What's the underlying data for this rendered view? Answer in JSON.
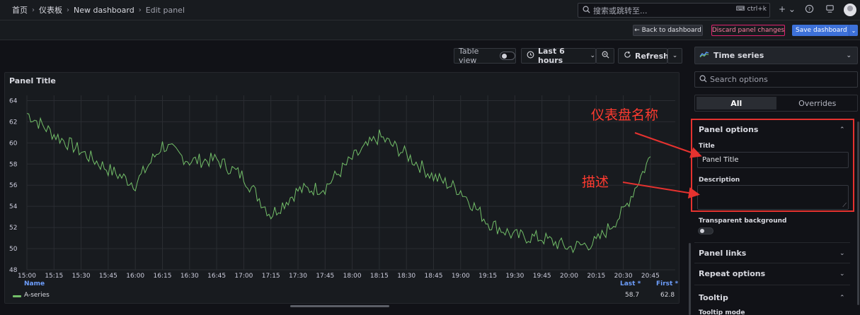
{
  "breadcrumbs": [
    "首页",
    "仪表板",
    "New dashboard",
    "Edit panel"
  ],
  "search": {
    "placeholder": "搜索或跳转至...",
    "shortcut": "ctrl+k"
  },
  "actions": {
    "back": "← Back to dashboard",
    "discard": "Discard panel changes",
    "save": "Save dashboard"
  },
  "toolbar": {
    "table_view": "Table view",
    "time_range": "Last 6 hours",
    "refresh": "Refresh"
  },
  "panel": {
    "title": "Panel Title"
  },
  "legend": {
    "name_header": "Name",
    "last_header": "Last *",
    "first_header": "First *",
    "series_name": "A-series",
    "last_value": "58.7",
    "first_value": "62.8"
  },
  "options": {
    "viz_type": "Time series",
    "search_placeholder": "Search options",
    "tab_all": "All",
    "tab_overrides": "Overrides",
    "panel_options": "Panel options",
    "title_label": "Title",
    "title_value": "Panel Title",
    "description_label": "Description",
    "description_value": "",
    "transparent_label": "Transparent background",
    "panel_links": "Panel links",
    "repeat_options": "Repeat options",
    "tooltip": "Tooltip",
    "tooltip_mode": "Tooltip mode"
  },
  "annotations": {
    "name_label": "仪表盘名称",
    "desc_label": "描述"
  },
  "colors": {
    "series": "#73bf69",
    "accent": "#3d71d9",
    "danger": "#e0226e",
    "annotation": "#e5322f"
  },
  "chart_data": {
    "type": "line",
    "x": [
      "15:00",
      "15:15",
      "15:30",
      "15:45",
      "16:00",
      "16:15",
      "16:30",
      "16:45",
      "17:00",
      "17:15",
      "17:30",
      "17:45",
      "18:00",
      "18:15",
      "18:30",
      "18:45",
      "19:00",
      "19:15",
      "19:30",
      "19:45",
      "20:00",
      "20:15",
      "20:30",
      "20:45"
    ],
    "x_ticks": [
      "15:00",
      "15:15",
      "15:30",
      "15:45",
      "16:00",
      "16:15",
      "16:30",
      "16:45",
      "17:00",
      "17:15",
      "17:30",
      "17:45",
      "18:00",
      "18:15",
      "18:30",
      "18:45",
      "19:00",
      "19:15",
      "19:30",
      "19:45",
      "20:00",
      "20:15",
      "20:30",
      "20:45"
    ],
    "series": [
      {
        "name": "A-series",
        "values": [
          62.8,
          60.8,
          59.2,
          57.5,
          56.1,
          59.8,
          58.3,
          58.4,
          56.8,
          53.2,
          55.5,
          55.8,
          58.5,
          60.6,
          58.9,
          56.8,
          55.5,
          52.5,
          51.2,
          51.0,
          50.1,
          50.6,
          53.5,
          58.7
        ]
      }
    ],
    "y_ticks": [
      48,
      50,
      52,
      54,
      56,
      58,
      60,
      62,
      64
    ],
    "ylim": [
      48,
      64.5
    ],
    "grid": true,
    "legend": "bottom"
  }
}
